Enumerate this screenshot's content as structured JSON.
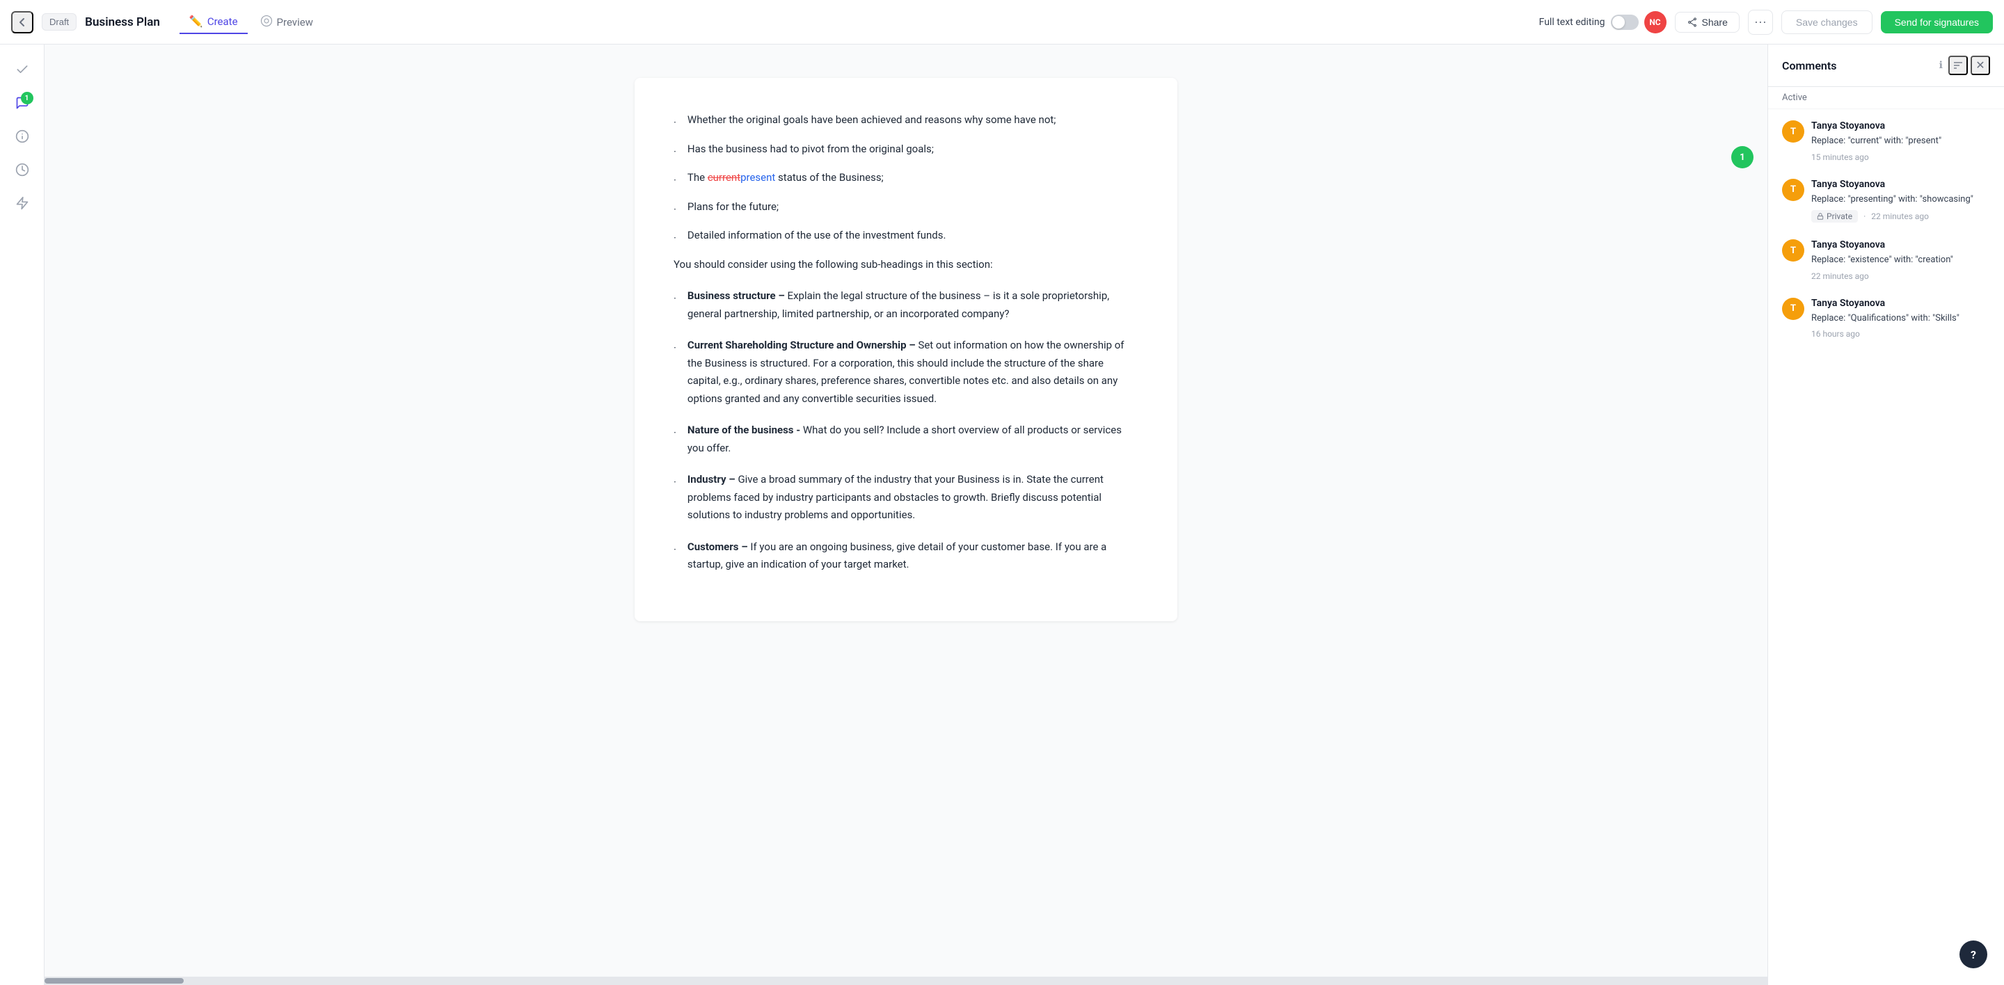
{
  "header": {
    "back_label": "←",
    "draft_label": "Draft",
    "doc_title": "Business Plan",
    "tabs": [
      {
        "id": "create",
        "label": "Create",
        "active": true,
        "icon": "✏️"
      },
      {
        "id": "preview",
        "label": "Preview",
        "active": false,
        "icon": "👁"
      }
    ],
    "full_text_editing_label": "Full text editing",
    "nc_badge": "NC",
    "share_label": "Share",
    "more_label": "···",
    "save_changes_label": "Save changes",
    "send_label": "Send for signatures"
  },
  "sidebar": {
    "icons": [
      {
        "id": "check",
        "symbol": "✓",
        "active": false
      },
      {
        "id": "comment",
        "symbol": "💬",
        "active": true,
        "badge": "1"
      },
      {
        "id": "info",
        "symbol": "ℹ",
        "active": false
      },
      {
        "id": "history",
        "symbol": "🕐",
        "active": false
      },
      {
        "id": "lightning",
        "symbol": "⚡",
        "active": false
      }
    ]
  },
  "document": {
    "bullets": [
      "Whether the original goals have been achieved and reasons why some have not;",
      "Has the business had to pivot from the original goals;",
      "The [current→present] status of the Business;",
      "Plans for the future;",
      "Detailed information of the use of the investment funds."
    ],
    "intro_para": "You should consider using the following sub-headings in this section:",
    "sections": [
      {
        "title": "Business structure",
        "title_suffix": " –",
        "body": "Explain the legal structure of the business – is it a sole proprietorship, general partnership, limited partnership, or an incorporated company?"
      },
      {
        "title": "Current Shareholding Structure and Ownership –",
        "body": "Set out information on how the ownership of the Business is structured. For a corporation, this should include the structure of the share capital, e.g., ordinary shares, preference shares, convertible notes etc. and also details on any options granted and any convertible securities issued."
      },
      {
        "title": "Nature of the business -",
        "body": "What do you sell? Include a short overview of all products or services you offer."
      },
      {
        "title": "Industry –",
        "body": "Give a broad summary of the industry that your Business is in. State the current problems faced by industry participants and obstacles to growth. Briefly discuss potential solutions to industry problems and opportunities."
      },
      {
        "title": "Customers –",
        "body": "If you are an ongoing business, give detail of your customer base. If you are a startup, give an indication of your target market."
      }
    ]
  },
  "comments_panel": {
    "title": "Comments",
    "filter_label": "Active",
    "comments": [
      {
        "id": 1,
        "author": "Tanya Stoyanova",
        "avatar_initials": "T",
        "text": "Replace: \"current\" with: \"present\"",
        "time_ago": "15 minutes ago",
        "private": false
      },
      {
        "id": 2,
        "author": "Tanya Stoyanova",
        "avatar_initials": "T",
        "text": "Replace: \"presenting\" with: \"showcasing\"",
        "time_ago": "22 minutes ago",
        "private": true,
        "private_label": "Private"
      },
      {
        "id": 3,
        "author": "Tanya Stoyanova",
        "avatar_initials": "T",
        "text": "Replace: \"existence\" with: \"creation\"",
        "time_ago": "22 minutes ago",
        "private": false
      },
      {
        "id": 4,
        "author": "Tanya Stoyanova",
        "avatar_initials": "T",
        "text": "Replace: \"Qualifications\" with: \"Skills\"",
        "time_ago": "16 hours ago",
        "private": false
      }
    ]
  },
  "help_btn_label": "?"
}
